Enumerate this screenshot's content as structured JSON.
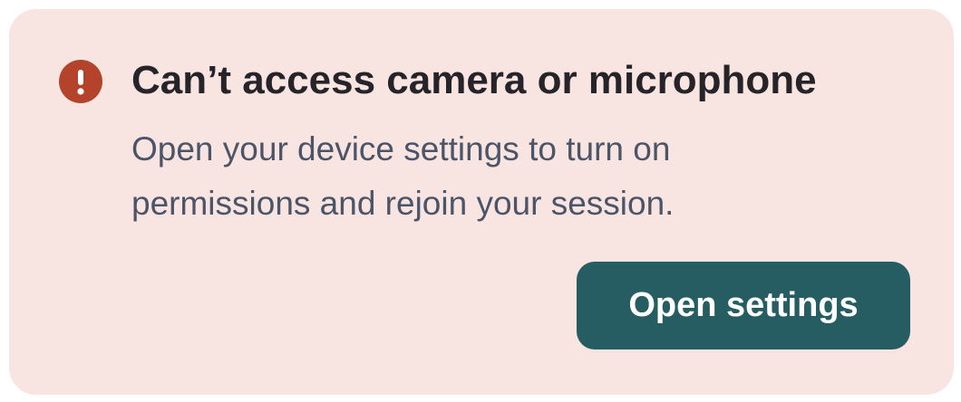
{
  "alert": {
    "icon": "exclamation-circle-icon",
    "title": "Can’t access camera or microphone",
    "message": "Open your device settings to turn on permissions and rejoin your session.",
    "action_label": "Open settings"
  },
  "colors": {
    "card_background": "#f8e5e2",
    "icon_background": "#b3432b",
    "title_text": "#262429",
    "body_text": "#4c5468",
    "button_background": "#265d63",
    "button_text": "#ffffff"
  }
}
